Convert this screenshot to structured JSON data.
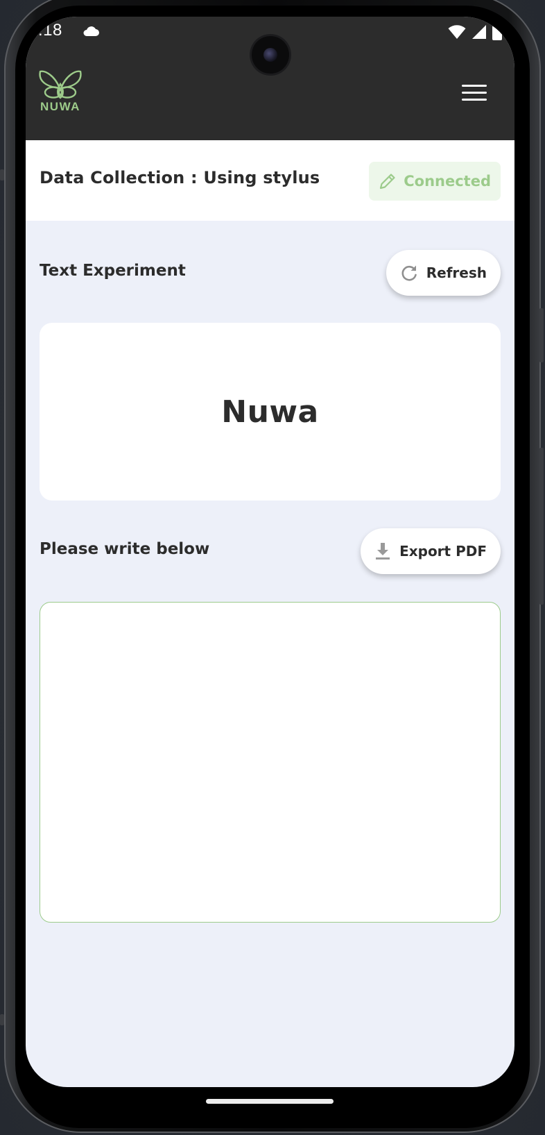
{
  "status_bar": {
    "time": ":18"
  },
  "app_bar": {
    "logo_text": "NUWA"
  },
  "header": {
    "title": "Data Collection : Using stylus",
    "status_badge": "Connected"
  },
  "experiment": {
    "section_label": "Text Experiment",
    "refresh_label": "Refresh",
    "target_word": "Nuwa"
  },
  "writing": {
    "section_label": "Please write below",
    "export_label": "Export PDF"
  },
  "colors": {
    "accent_green": "#9ccb8b",
    "app_bar_bg": "#2c2c2c",
    "content_bg": "#edf0f9"
  }
}
